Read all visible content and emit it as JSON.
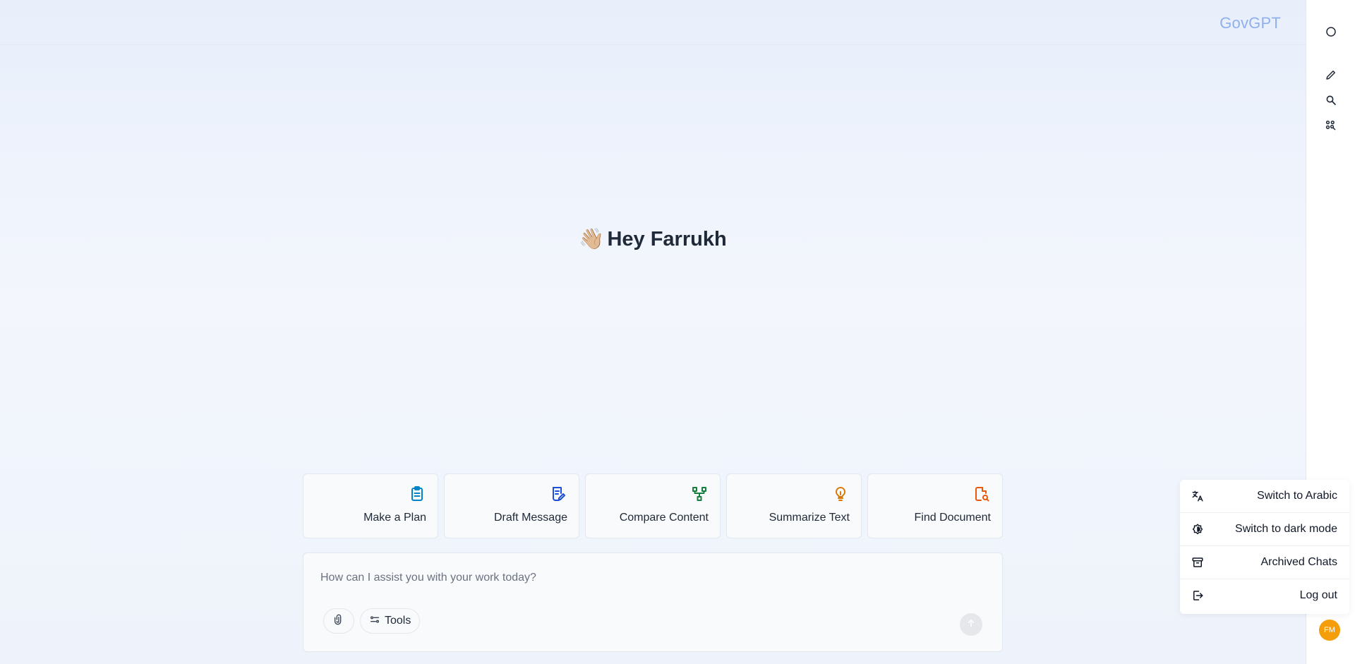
{
  "header": {
    "brand": "GovGPT"
  },
  "rail": {
    "icons": [
      "circle-icon",
      "pencil-icon",
      "search-icon",
      "apps-search-icon"
    ]
  },
  "greeting": {
    "emoji": "👋🏼",
    "text": "Hey Farrukh"
  },
  "cards": [
    {
      "label": "Make a Plan",
      "icon": "clipboard-icon",
      "color": "#0284c7"
    },
    {
      "label": "Draft Message",
      "icon": "draft-icon",
      "color": "#1d4ed8"
    },
    {
      "label": "Compare Content",
      "icon": "compare-icon",
      "color": "#15803d"
    },
    {
      "label": "Summarize Text",
      "icon": "lightbulb-icon",
      "color": "#d97706"
    },
    {
      "label": "Find Document",
      "icon": "document-search-icon",
      "color": "#ea580c"
    }
  ],
  "composer": {
    "placeholder": "How can I assist you with your work today?",
    "value": "",
    "tools_label": "Tools"
  },
  "menu": {
    "items": [
      {
        "label": "Switch to Arabic",
        "icon": "translate-icon"
      },
      {
        "label": "Switch to dark mode",
        "icon": "theme-icon"
      },
      {
        "label": "Archived Chats",
        "icon": "archive-icon"
      },
      {
        "label": "Log out",
        "icon": "logout-icon"
      }
    ]
  },
  "user": {
    "initials": "FM",
    "avatar_color": "#f59e0b"
  }
}
